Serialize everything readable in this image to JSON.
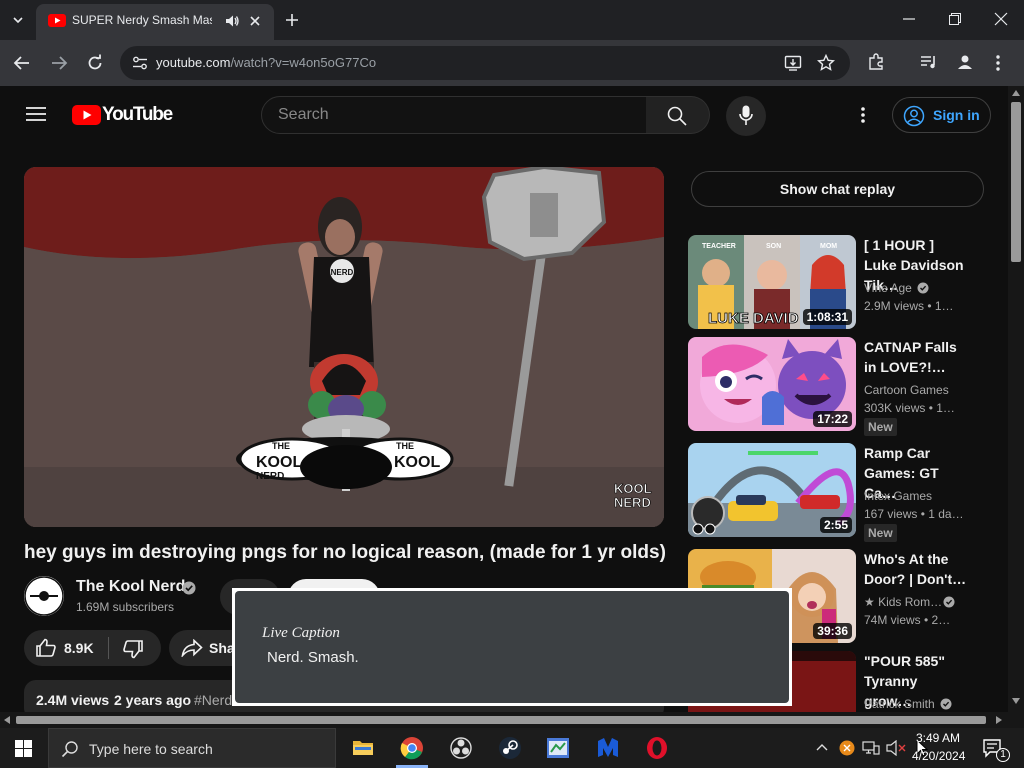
{
  "browser": {
    "tab_title": "SUPER Nerdy Smash Mash",
    "url_domain": "youtube.com",
    "url_path": "/watch?v=w4on5oG77Co"
  },
  "header": {
    "logo_text": "YouTube",
    "search_placeholder": "Search",
    "signin_label": "Sign in"
  },
  "player": {
    "watermark_line1": "KOOL",
    "watermark_line2": "NERD",
    "plate_left_line1": "THE",
    "plate_left_line2": "KOOL",
    "plate_left_line3": "NERD",
    "plate_right_line1": "THE",
    "plate_right_line2": "KOOL",
    "shirt_text": "NERD"
  },
  "video": {
    "title": "hey guys im destroying pngs for no logical reason, (made for 1 yr olds)",
    "channel_name": "The Kool Nerd",
    "channel_avatar_text": "THE KOOL NERD",
    "subscribers": "1.69M subscribers",
    "likes": "8.9K",
    "share_label": "Sha",
    "views": "2.4M views",
    "age": "2 years ago",
    "hashtag": "#Nerd"
  },
  "sidebar": {
    "chat_replay_label": "Show chat replay",
    "recommendations": [
      {
        "title": "[ 1 HOUR ] Luke Davidson Tik…",
        "channel": "Vine Age",
        "meta": "2.9M views  • 1…",
        "duration": "1:08:31",
        "thumb_text": "LUKE DAVID",
        "labels": [
          "TEACHER",
          "SON",
          "MOM"
        ],
        "new": ""
      },
      {
        "title": "CATNAP Falls in LOVE?!…",
        "channel": "Cartoon Games",
        "meta": "303K views  • 1…",
        "duration": "17:22",
        "new": "New"
      },
      {
        "title": "Ramp Car Games: GT Ca…",
        "channel": "Intex Games",
        "meta": "167 views  • 1 da…",
        "duration": "2:55",
        "new": "New"
      },
      {
        "title": "Who's At the Door? | Don't…",
        "channel": "★ Kids Rom…",
        "meta": "74M views  • 2…",
        "duration": "39:36",
        "new": ""
      },
      {
        "title": "\"POUR 585\" Tyranny grow…",
        "channel": "Patrick Smith",
        "meta": "",
        "duration": "",
        "new": ""
      }
    ]
  },
  "live_caption": {
    "title": "Live Caption",
    "text": "Nerd. Smash."
  },
  "taskbar": {
    "search_placeholder": "Type here to search",
    "time": "3:49 AM",
    "date": "4/20/2024",
    "notification_count": "1"
  },
  "colors": {
    "youtube_red": "#ff0000",
    "link_blue": "#3ea6ff",
    "background": "#0f0f0f"
  }
}
